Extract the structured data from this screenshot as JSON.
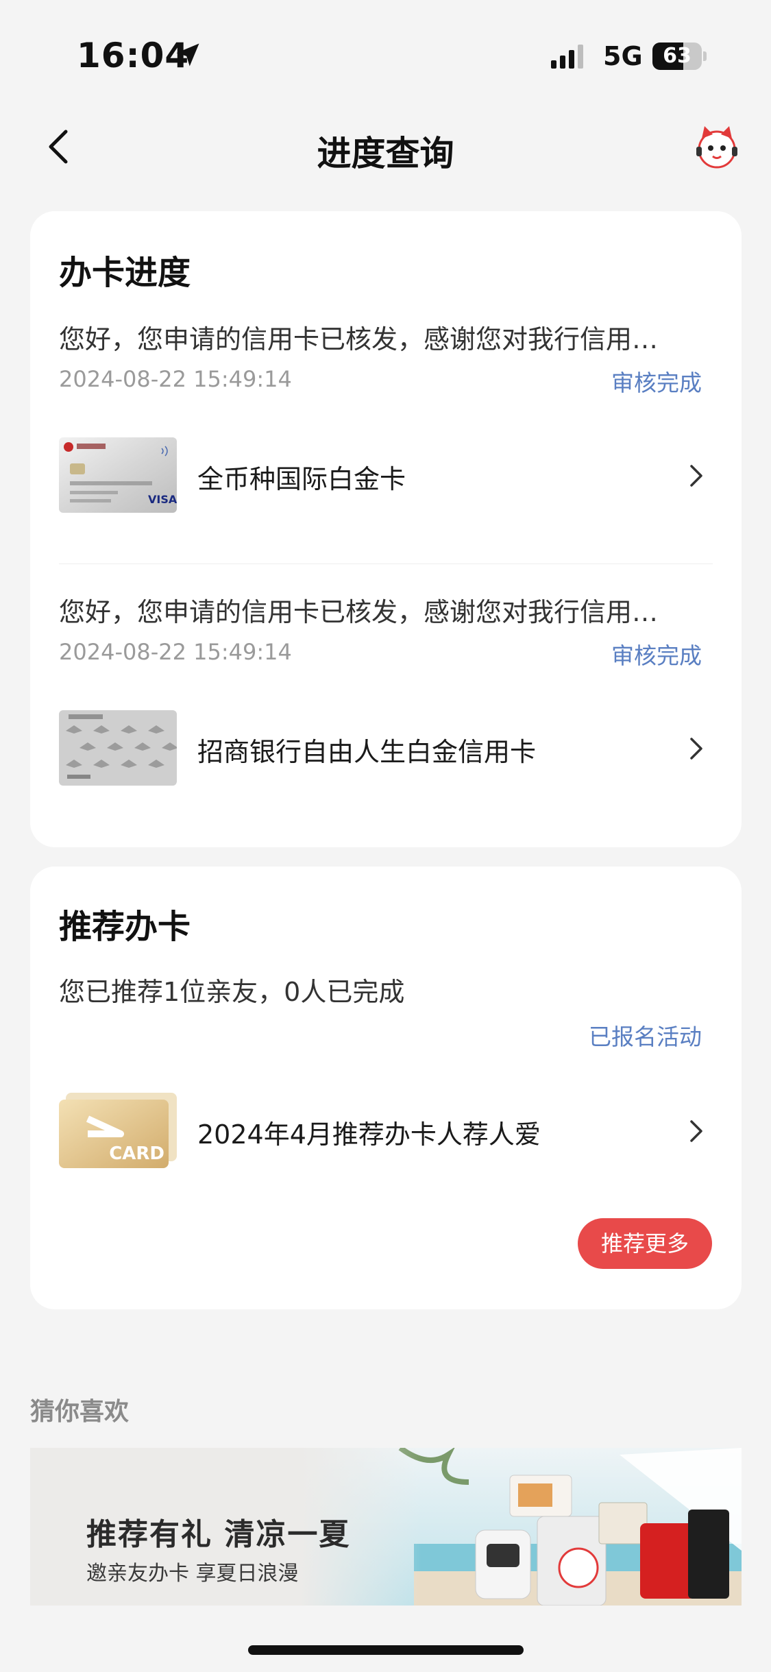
{
  "status_bar": {
    "time": "16:04",
    "network": "5G",
    "battery_level": "63",
    "battery_fraction": 0.63,
    "location_icon": "location-arrow-icon",
    "signal_icon": "signal-bars-icon"
  },
  "nav": {
    "title": "进度查询",
    "back_icon": "chevron-left-icon",
    "service_icon": "mascot-cat-icon"
  },
  "progress": {
    "title": "办卡进度",
    "items": [
      {
        "message": "您好，您申请的信用卡已核发，感谢您对我行信用…",
        "date": "2024-08-22 15:49:14",
        "status": "审核完成",
        "card_name": "全币种国际白金卡"
      },
      {
        "message": "您好，您申请的信用卡已核发，感谢您对我行信用…",
        "date": "2024-08-22 15:49:14",
        "status": "审核完成",
        "card_name": "招商银行自由人生白金信用卡"
      }
    ]
  },
  "recommend": {
    "title": "推荐办卡",
    "summary": "您已推荐1位亲友，0人已完成",
    "activity_link": "已报名活动",
    "activity_name": "2024年4月推荐办卡人荐人爱",
    "card_badge": "CARD",
    "more_button": "推荐更多"
  },
  "guess": {
    "title": "猜你喜欢",
    "banner_headline": "推荐有礼 清凉一夏",
    "banner_sub": "邀亲友办卡 享夏日浪漫"
  },
  "colors": {
    "background": "#f4f4f4",
    "link_blue": "#5a7fc2",
    "accent_red": "#e84a4a"
  }
}
